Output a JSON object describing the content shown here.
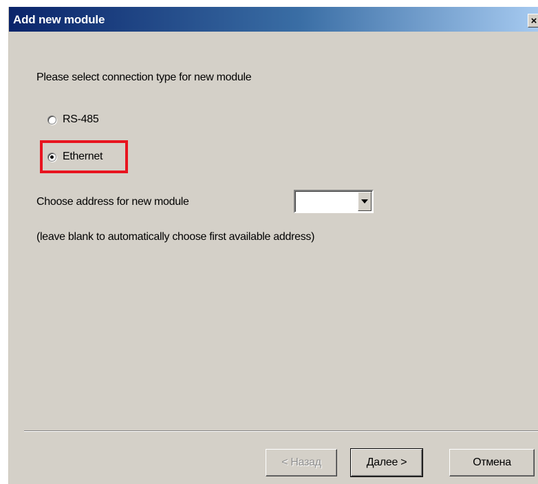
{
  "window": {
    "title": "Add new module",
    "close_label": "×"
  },
  "prompt": "Please select connection type for new module",
  "connection": {
    "options": [
      {
        "label": "RS-485",
        "selected": false
      },
      {
        "label": "Ethernet",
        "selected": true
      }
    ]
  },
  "address": {
    "label": "Choose address for new module",
    "value": "",
    "hint": "(leave blank to automatically choose first available address)"
  },
  "buttons": {
    "back": "< Назад",
    "next": "Далее >",
    "cancel": "Отмена"
  },
  "colors": {
    "highlight": "#e8141f",
    "title_bar_start": "#0a246a",
    "title_bar_end": "#a6caf0"
  }
}
